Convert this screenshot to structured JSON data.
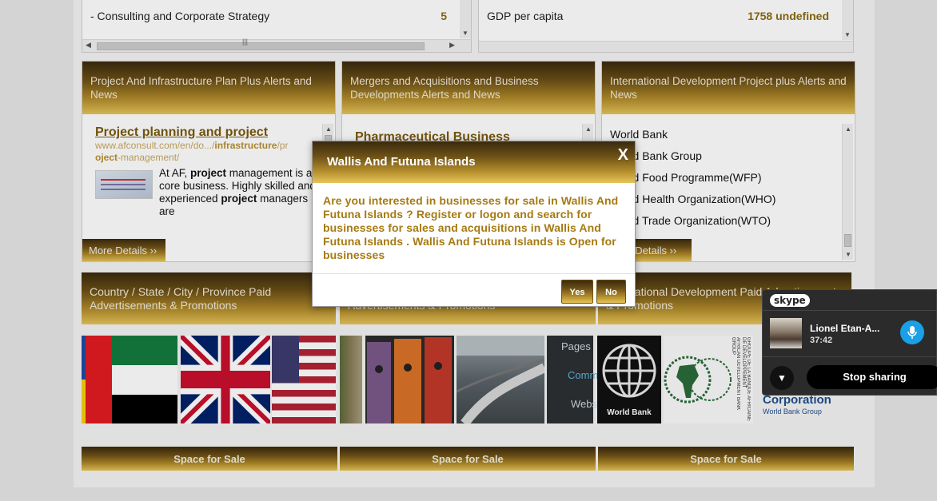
{
  "top_boxes": [
    {
      "label": "- Consulting and Corporate Strategy",
      "value": "5"
    },
    {
      "label": "GDP per capita",
      "value": "1758 undefined"
    }
  ],
  "panels": [
    {
      "header": "Project And Infrastructure Plan Plus Alerts and News",
      "result": {
        "title": "Project planning and project",
        "url_pre": "www.afconsult.com/en/do.../",
        "url_bold1": "infrastructure",
        "url_mid": "/pr",
        "url_bold2": "oject",
        "url_post": "-management/",
        "desc_parts": [
          "At AF, ",
          "project",
          " management is a core business. Highly skilled and experienced ",
          "project",
          " managers are"
        ]
      },
      "more": "More Details ››"
    },
    {
      "header": "Mergers and Acquisitions and Business Developments Alerts and News",
      "result": {
        "title": "Pharmaceutical Business"
      }
    },
    {
      "header": "International Development Project plus Alerts and News",
      "orgs": [
        "World Bank",
        "World Bank Group",
        "World Food Programme(WFP)",
        "World Health Organization(WHO)",
        "World Trade Organization(WTO)"
      ],
      "more": "More Details ››"
    }
  ],
  "row2_headers": [
    "Country / State / City / Province Paid Advertisements & Promotions",
    "Advertisements & Promotions",
    "International Development Paid Advertisements & Promotions"
  ],
  "images": {
    "pages_text": "Pages",
    "comm_text": "Comm",
    "webs_text": "Webs",
    "world_bank_label": "World Bank",
    "afdb_text": "AFRICAN DEVELOPMENT BANK GROUP",
    "afdb_text_fr": "GROUPE DE LA BANQUE AFRICAINE DE DEVELOPPEMENT",
    "ifc_title": "Corporation",
    "ifc_sub": "World Bank Group"
  },
  "space_buttons": [
    "Space for Sale",
    "Space for Sale",
    "Space for Sale"
  ],
  "modal": {
    "title": "Wallis And Futuna Islands",
    "close": "X",
    "message": "Are you interested in businesses for sale in Wallis And Futuna Islands ? Register or logon and search for businesses for sales and acquisitions in Wallis And Futuna Islands . Wallis And Futuna Islands is Open for businesses",
    "yes": "Yes",
    "no": "No"
  },
  "skype": {
    "logo": "skype",
    "caller": "Lionel  Etan-A...",
    "duration": "37:42",
    "stop": "Stop sharing"
  }
}
